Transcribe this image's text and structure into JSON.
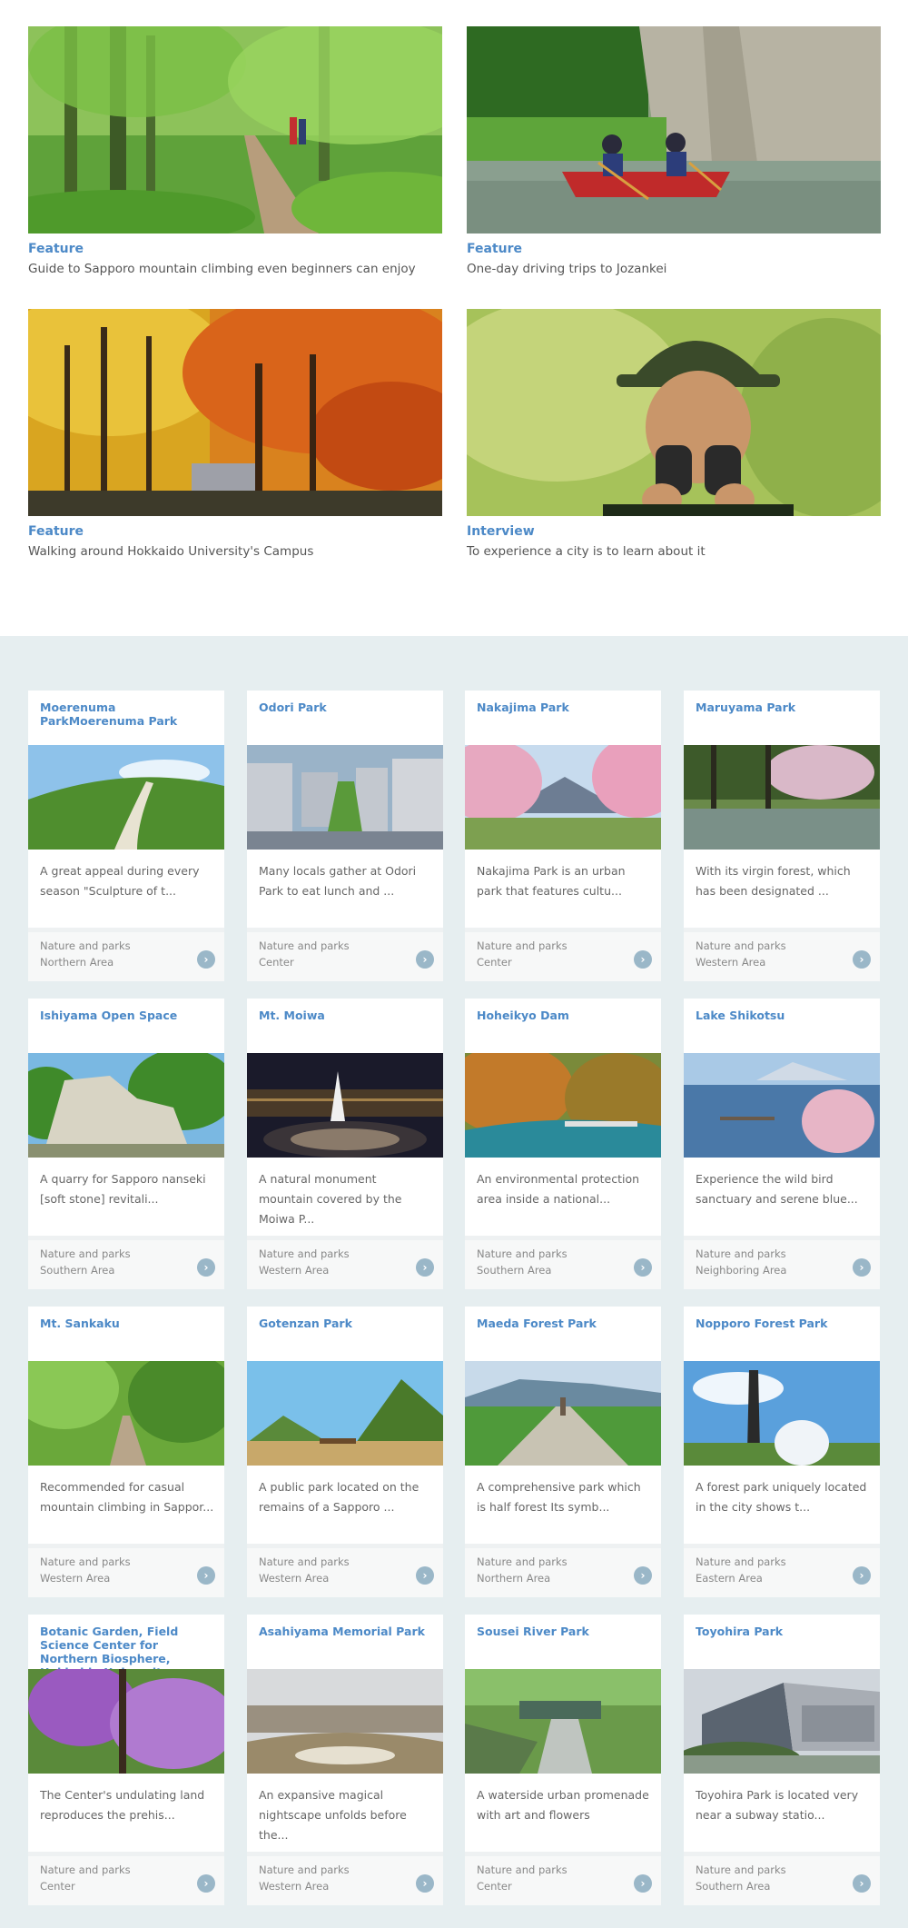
{
  "features": [
    {
      "tag": "Feature",
      "title": "Guide to Sapporo mountain climbing even beginners can enjoy",
      "image": "forest-trail-photo"
    },
    {
      "tag": "Feature",
      "title": "One-day driving trips to Jozankei",
      "image": "canoe-river-photo"
    },
    {
      "tag": "Feature",
      "title": "Walking around Hokkaido University's Campus",
      "image": "autumn-trees-photo"
    },
    {
      "tag": "Interview",
      "title": "To experience a city is to learn about it",
      "image": "man-binoculars-photo"
    }
  ],
  "spots": [
    {
      "name": "Moerenuma ParkMoerenuma Park",
      "desc": "A great appeal during every season \"Sculpture of t...",
      "category": "Nature and parks",
      "area": "Northern Area"
    },
    {
      "name": "Odori Park",
      "desc": "Many locals gather at Odori Park to eat lunch and ...",
      "category": "Nature and parks",
      "area": "Center"
    },
    {
      "name": "Nakajima Park",
      "desc": "Nakajima Park is an urban park that features cultu...",
      "category": "Nature and parks",
      "area": "Center"
    },
    {
      "name": "Maruyama Park",
      "desc": "With its virgin forest, which has been designated ...",
      "category": "Nature and parks",
      "area": "Western Area"
    },
    {
      "name": "Ishiyama Open Space",
      "desc": "A quarry for Sapporo nanseki [soft stone] revitali...",
      "category": "Nature and parks",
      "area": "Southern Area"
    },
    {
      "name": "Mt. Moiwa",
      "desc": "A natural monument mountain covered by the Moiwa P...",
      "category": "Nature and parks",
      "area": "Western Area"
    },
    {
      "name": "Hoheikyo Dam",
      "desc": "An environmental protection area inside a national...",
      "category": "Nature and parks",
      "area": "Southern Area"
    },
    {
      "name": "Lake Shikotsu",
      "desc": "Experience the wild bird sanctuary and serene blue...",
      "category": "Nature and parks",
      "area": "Neighboring Area"
    },
    {
      "name": "Mt. Sankaku",
      "desc": "Recommended for casual mountain climbing in Sappor...",
      "category": "Nature and parks",
      "area": "Western Area"
    },
    {
      "name": "Gotenzan Park",
      "desc": "A public park located on the remains of a Sapporo ...",
      "category": "Nature and parks",
      "area": "Western Area"
    },
    {
      "name": "Maeda Forest Park",
      "desc": "A comprehensive park which is half forest Its symb...",
      "category": "Nature and parks",
      "area": "Northern Area"
    },
    {
      "name": "Nopporo Forest Park",
      "desc": "A forest park uniquely located in the city shows t...",
      "category": "Nature and parks",
      "area": "Eastern Area"
    },
    {
      "name": "Botanic Garden, Field Science Center for Northern Biosphere, Hokkaido University",
      "desc": "The Center's undulating land reproduces the prehis...",
      "category": "Nature and parks",
      "area": "Center"
    },
    {
      "name": "Asahiyama Memorial Park",
      "desc": "An expansive magical nightscape unfolds before the...",
      "category": "Nature and parks",
      "area": "Western Area"
    },
    {
      "name": "Sousei River Park",
      "desc": "A waterside urban promenade with art and flowers",
      "category": "Nature and parks",
      "area": "Center"
    },
    {
      "name": "Toyohira Park",
      "desc": "Toyohira Park is located very near a subway statio...",
      "category": "Nature and parks",
      "area": "Southern Area"
    }
  ],
  "arrow_glyph": "›",
  "colors": {
    "link_blue": "#4c89c7",
    "section_bg": "#e6eef0",
    "arrow_bg": "#9ab7c8"
  }
}
